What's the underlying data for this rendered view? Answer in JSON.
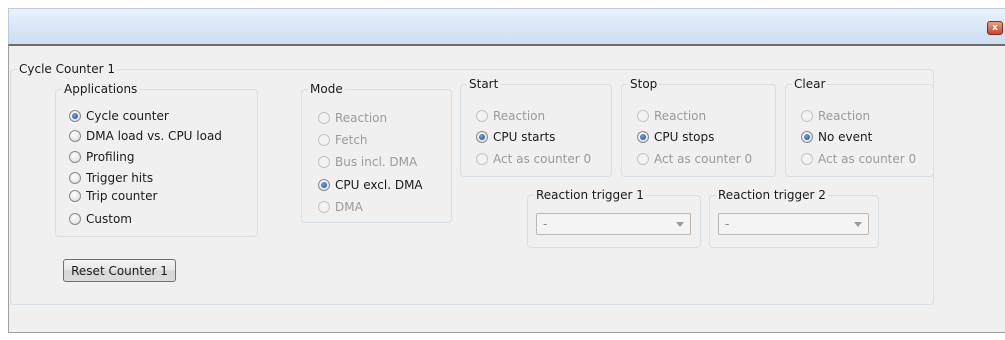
{
  "window": {
    "close_glyph": "x"
  },
  "cycle_counter": {
    "title": "Cycle Counter 1",
    "applications": {
      "title": "Applications",
      "options": [
        "Cycle counter",
        "DMA load vs. CPU load",
        "Profiling",
        "Trigger hits",
        "Trip counter",
        "Custom"
      ],
      "selected": "Cycle counter"
    },
    "mode": {
      "title": "Mode",
      "options": [
        "Reaction",
        "Fetch",
        "Bus incl. DMA",
        "CPU excl. DMA",
        "DMA"
      ],
      "selected": "CPU excl. DMA"
    },
    "start": {
      "title": "Start",
      "options": [
        "Reaction",
        "CPU starts",
        "Act as counter 0"
      ],
      "selected": "CPU starts"
    },
    "stop": {
      "title": "Stop",
      "options": [
        "Reaction",
        "CPU stops",
        "Act as counter 0"
      ],
      "selected": "CPU stops"
    },
    "clear": {
      "title": "Clear",
      "options": [
        "Reaction",
        "No event",
        "Act as counter 0"
      ],
      "selected": "No event"
    },
    "reaction_trigger_1": {
      "title": "Reaction trigger 1",
      "value": "-"
    },
    "reaction_trigger_2": {
      "title": "Reaction trigger 2",
      "value": "-"
    },
    "reset_button": "Reset Counter 1"
  },
  "colors": {
    "accent": "#1c4f91",
    "titlebar": "#d7e5f5",
    "close": "#c9452c"
  }
}
